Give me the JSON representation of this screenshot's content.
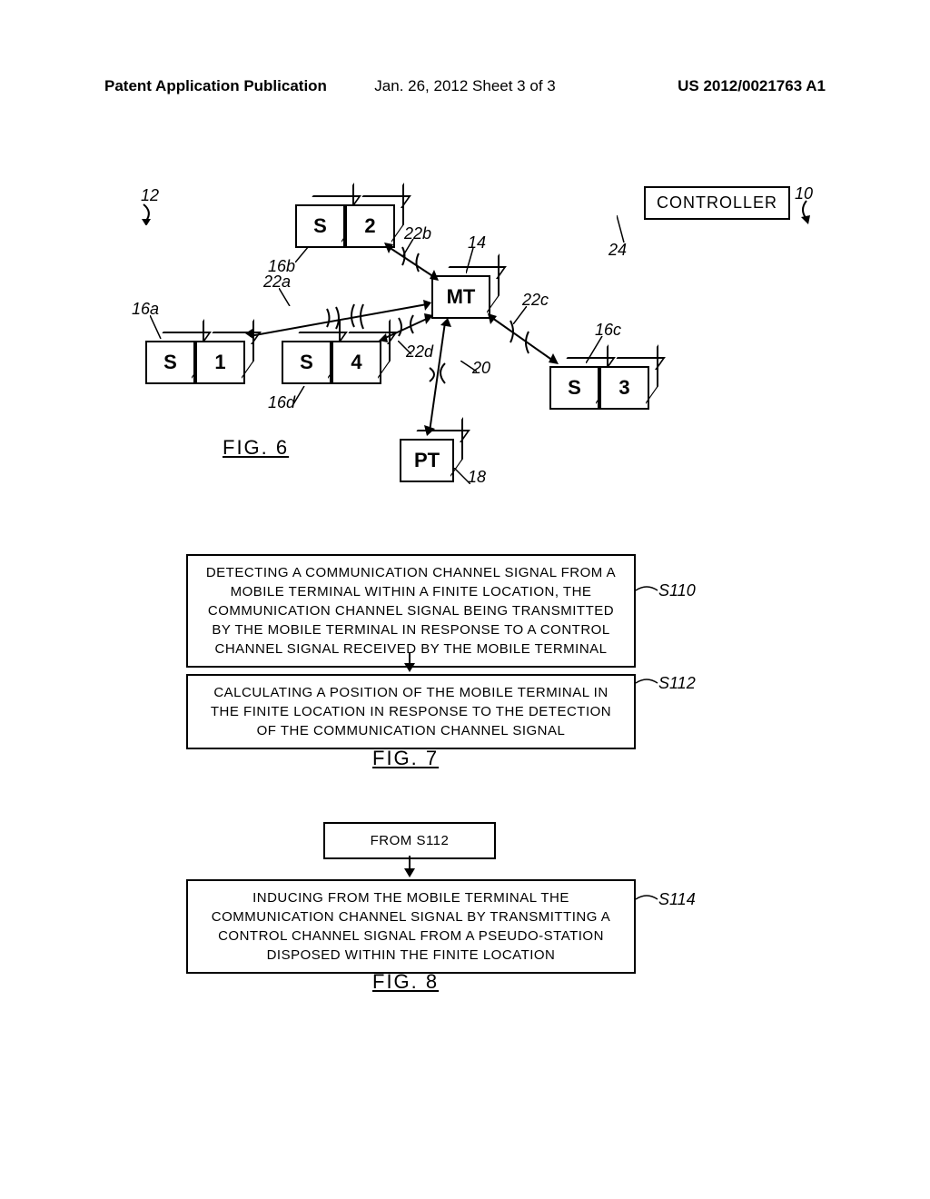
{
  "header": {
    "left": "Patent Application Publication",
    "center": "Jan. 26, 2012  Sheet 3 of 3",
    "right": "US 2012/0021763 A1"
  },
  "fig6": {
    "controller": "CONTROLLER",
    "boxes": {
      "s1": {
        "s": "S",
        "n": "1"
      },
      "s2": {
        "s": "S",
        "n": "2"
      },
      "s3": {
        "s": "S",
        "n": "3"
      },
      "s4": {
        "s": "S",
        "n": "4"
      },
      "mt": "MT",
      "pt": "PT"
    },
    "labels": {
      "l12": "12",
      "l10": "10",
      "l14": "14",
      "l24": "24",
      "l16a": "16a",
      "l16b": "16b",
      "l16c": "16c",
      "l16d": "16d",
      "l18": "18",
      "l20": "20",
      "l22a": "22a",
      "l22b": "22b",
      "l22c": "22c",
      "l22d": "22d"
    },
    "caption": "FIG.  6"
  },
  "fig7": {
    "s110_text": "DETECTING A COMMUNICATION CHANNEL SIGNAL FROM A MOBILE TERMINAL WITHIN A FINITE LOCATION, THE COMMUNICATION CHANNEL SIGNAL BEING TRANSMITTED BY THE MOBILE TERMINAL IN RESPONSE TO A CONTROL CHANNEL SIGNAL RECEIVED BY THE MOBILE TERMINAL",
    "s110_label": "S110",
    "s112_text": "CALCULATING A POSITION OF THE MOBILE TERMINAL IN THE FINITE LOCATION IN RESPONSE TO THE DETECTION OF THE COMMUNICATION CHANNEL SIGNAL",
    "s112_label": "S112",
    "caption": "FIG.  7"
  },
  "fig8": {
    "from_text": "FROM S112",
    "s114_text": "INDUCING FROM THE MOBILE TERMINAL THE COMMUNICATION CHANNEL SIGNAL BY TRANSMITTING A CONTROL CHANNEL SIGNAL FROM A PSEUDO-STATION DISPOSED WITHIN THE FINITE LOCATION",
    "s114_label": "S114",
    "caption": "FIG.  8"
  }
}
